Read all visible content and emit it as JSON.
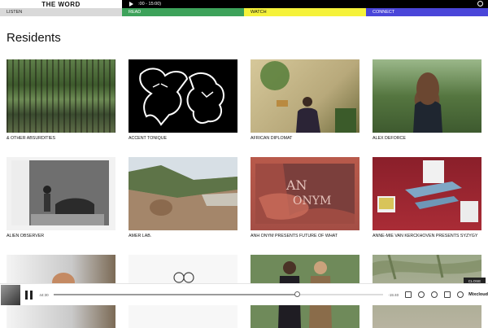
{
  "header": {
    "logo_text": "THE WORD",
    "player_time": ":00 - 15:00)"
  },
  "nav": [
    {
      "label": "LISTEN"
    },
    {
      "label": "READ"
    },
    {
      "label": "WATCH"
    },
    {
      "label": "CONNECT"
    }
  ],
  "page_title": "Residents",
  "residents": [
    {
      "label": "& OTHER ABSURDITIES"
    },
    {
      "label": "ACCENT TONIQUE"
    },
    {
      "label": "AFRICAN DIPLOMAT"
    },
    {
      "label": "ALEX DEFORCE"
    },
    {
      "label": "ALIEN OBSERVER"
    },
    {
      "label": "AMER LAB."
    },
    {
      "label": "ANH ONYM PRESENTS FUTURE OF WHAT"
    },
    {
      "label": "ANNE-MIE VAN KERCKHOVEN PRESENTS SYZYGY"
    }
  ],
  "bottom_player": {
    "elapsed": "44:30",
    "remaining": "-15:40",
    "progress": 0.74,
    "brand": "Mixcloud",
    "close_label": "CLOSE"
  },
  "colors": {
    "listen": "#d9d9d9",
    "read": "#3da25a",
    "watch": "#f5f23a",
    "connect": "#4a46d9"
  }
}
